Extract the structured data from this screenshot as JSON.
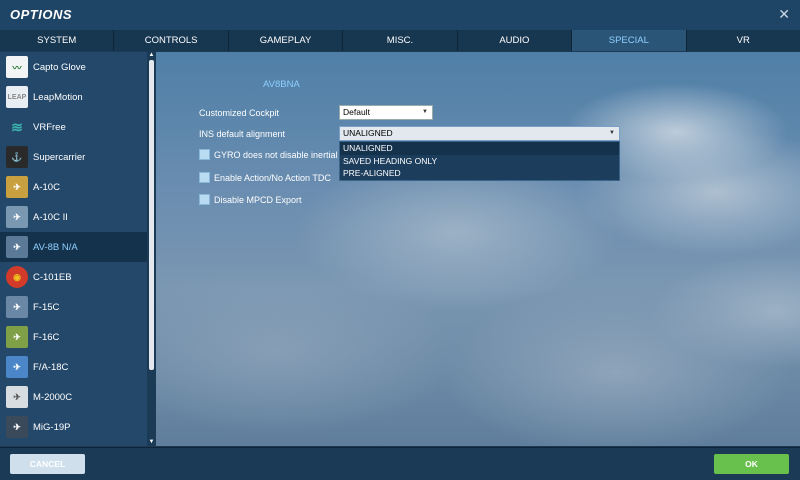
{
  "window": {
    "title": "OPTIONS",
    "close_glyph": "✕"
  },
  "tabs": [
    {
      "label": "SYSTEM"
    },
    {
      "label": "CONTROLS"
    },
    {
      "label": "GAMEPLAY"
    },
    {
      "label": "MISC."
    },
    {
      "label": "AUDIO"
    },
    {
      "label": "SPECIAL",
      "active": true
    },
    {
      "label": "VR"
    }
  ],
  "sidebar": {
    "items": [
      {
        "label": "Capto Glove",
        "icon": "capto-glove-logo-icon",
        "color": "#2f7d3a"
      },
      {
        "label": "LeapMotion",
        "icon": "leapmotion-logo-icon",
        "color": "#e8eef2"
      },
      {
        "label": "VRFree",
        "icon": "vrfree-logo-icon",
        "color": "#3cb3b0"
      },
      {
        "label": "Supercarrier",
        "icon": "supercarrier-icon",
        "color": "#c04a20"
      },
      {
        "label": "A-10C",
        "icon": "a-10c-icon",
        "color": "#c8a040"
      },
      {
        "label": "A-10C II",
        "icon": "a-10c-ii-icon",
        "color": "#7a98b2"
      },
      {
        "label": "AV-8B N/A",
        "icon": "av-8b-icon",
        "color": "#5a7a98",
        "active": true
      },
      {
        "label": "C-101EB",
        "icon": "c-101eb-icon",
        "color": "#d23a2a"
      },
      {
        "label": "F-15C",
        "icon": "f-15c-icon",
        "color": "#6a88a6"
      },
      {
        "label": "F-16C",
        "icon": "f-16c-icon",
        "color": "#7fa046"
      },
      {
        "label": "F/A-18C",
        "icon": "fa-18c-icon",
        "color": "#4a86c8"
      },
      {
        "label": "M-2000C",
        "icon": "m-2000c-icon",
        "color": "#d8dde2"
      },
      {
        "label": "MiG-19P",
        "icon": "mig-19p-icon",
        "color": "#3a4a5a"
      }
    ]
  },
  "scrollbar": {
    "up": "▲",
    "down": "▼"
  },
  "main": {
    "section_title": "AV8BNA",
    "customized_cockpit": {
      "label": "Customized Cockpit",
      "value": "Default"
    },
    "ins_alignment": {
      "label": "INS default alignment",
      "value": "UNALIGNED",
      "options": [
        "UNALIGNED",
        "SAVED HEADING ONLY",
        "PRE-ALIGNED"
      ]
    },
    "checkboxes": [
      {
        "label": "GYRO does not disable inertial nav"
      },
      {
        "label": "Enable Action/No Action TDC"
      },
      {
        "label": "Disable MPCD Export"
      }
    ]
  },
  "footer": {
    "cancel_label": "CANCEL",
    "ok_label": "OK"
  },
  "colors": {
    "accent": "#8fd0ff",
    "ok": "#69c14d",
    "titlebar": "#1f4566"
  }
}
